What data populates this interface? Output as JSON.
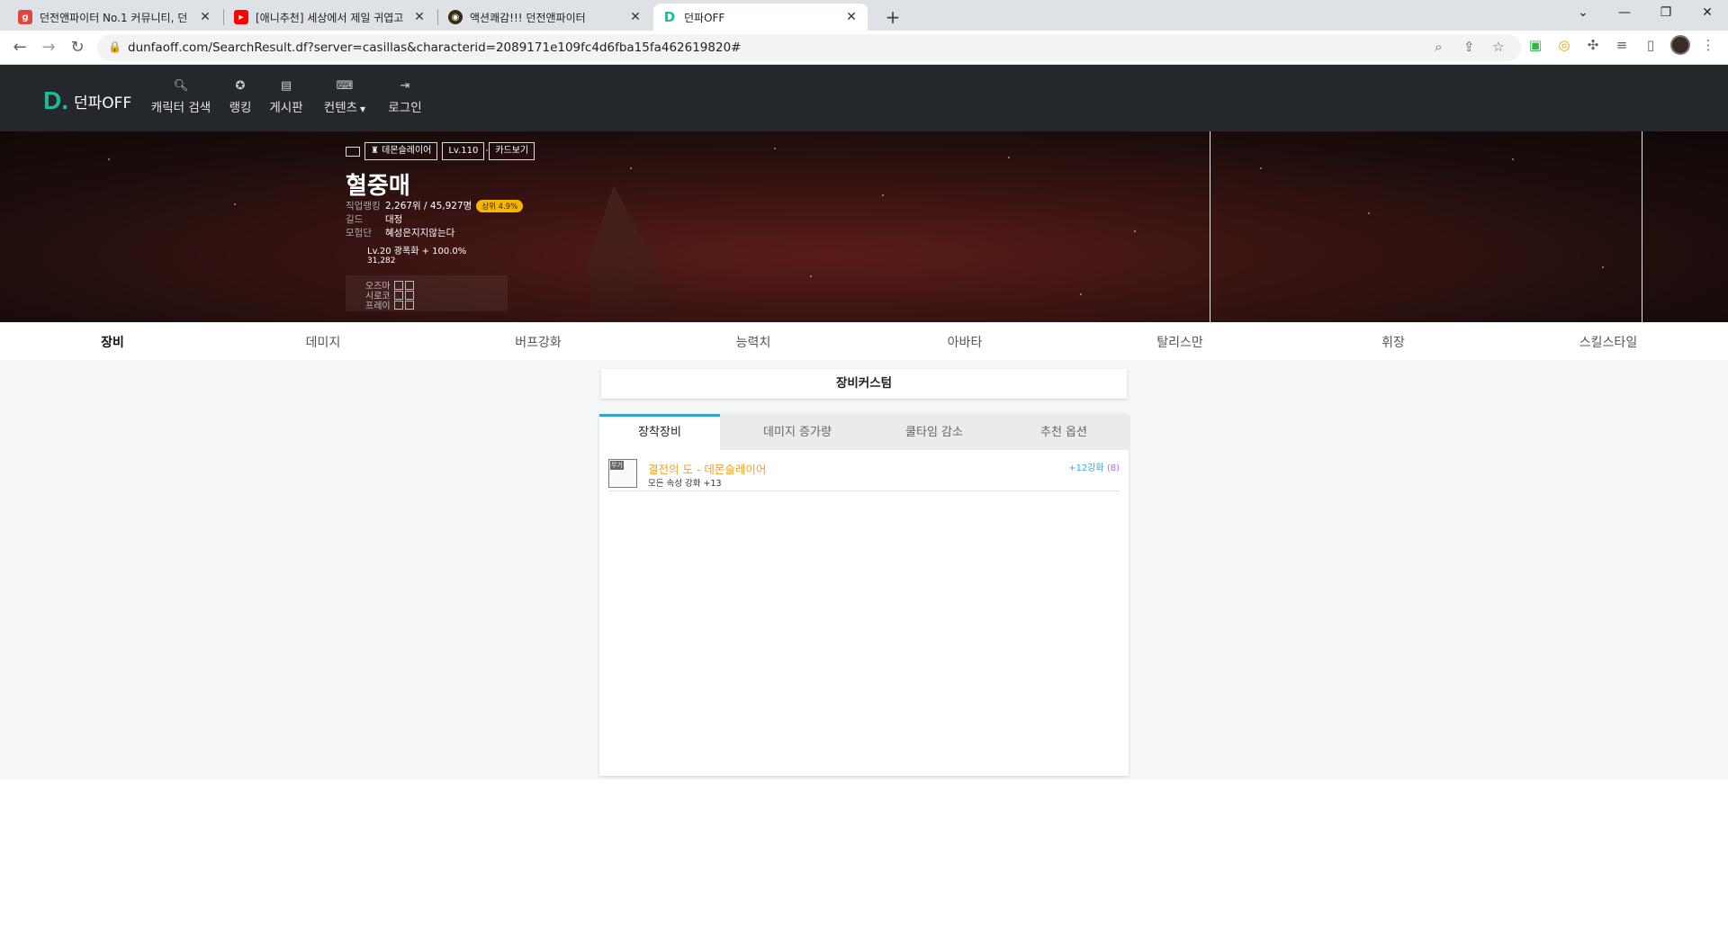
{
  "browser": {
    "tabs": [
      {
        "title": "던전앤파이터 No.1 커뮤니티, 던",
        "favicon": "g",
        "color": "#e0463a"
      },
      {
        "title": "[애니추천] 세상에서 제일 귀엽고",
        "favicon": "▶",
        "color": "#ff0000"
      },
      {
        "title": "액션쾌감!!! 던전앤파이터",
        "favicon": "◉",
        "color": "#3a2a10"
      },
      {
        "title": "던파OFF",
        "favicon": "D",
        "color": "#1abc9c"
      }
    ],
    "url": "dunfaoff.com/SearchResult.df?server=casillas&characterid=2089171e109fc4d6fba15fa462619820#"
  },
  "site": {
    "logo_text": "던파OFF",
    "nav": [
      {
        "label": "캐릭터 검색",
        "icon": "search-icon"
      },
      {
        "label": "랭킹",
        "icon": "ribbon-icon"
      },
      {
        "label": "게시판",
        "icon": "clipboard-icon"
      },
      {
        "label": "컨텐츠",
        "icon": "gamepad-icon"
      },
      {
        "label": "로그인",
        "icon": "login-icon"
      }
    ]
  },
  "character": {
    "job_badge": "데몬슬레이어",
    "level_badge": "Lv.110",
    "card_badge": "카드보기",
    "name": "혈중매",
    "job_rank_label": "직업랭킹",
    "job_rank_value": "2,267위 / 45,927명",
    "rank_pill": "상위 4.9%",
    "guild_label": "길드",
    "guild_value": "대정",
    "adventure_label": "모험단",
    "adventure_value": "혜성은지지않는다",
    "awaken_line": "Lv.20 광폭화 + 100.0%",
    "number_line": "31,282",
    "mini_rows": [
      "오즈마",
      "시로코",
      "프레이"
    ]
  },
  "section_tabs": [
    "장비",
    "데미지",
    "버프강화",
    "능력치",
    "아바타",
    "탈리스만",
    "휘장",
    "스킬스타일"
  ],
  "active_section": "장비",
  "custom_title": "장비커스텀",
  "panel_tabs": [
    "장착장비",
    "데미지 증가량",
    "쿨타임 감소",
    "추천 옵션"
  ],
  "equipment": [
    {
      "icon_tag": "무기",
      "name": "결전의 도 - 데몬슬레이어",
      "sub": "모든 속성 강화 +13",
      "enhance": "+12강화",
      "enhance_level": "(8)"
    }
  ]
}
